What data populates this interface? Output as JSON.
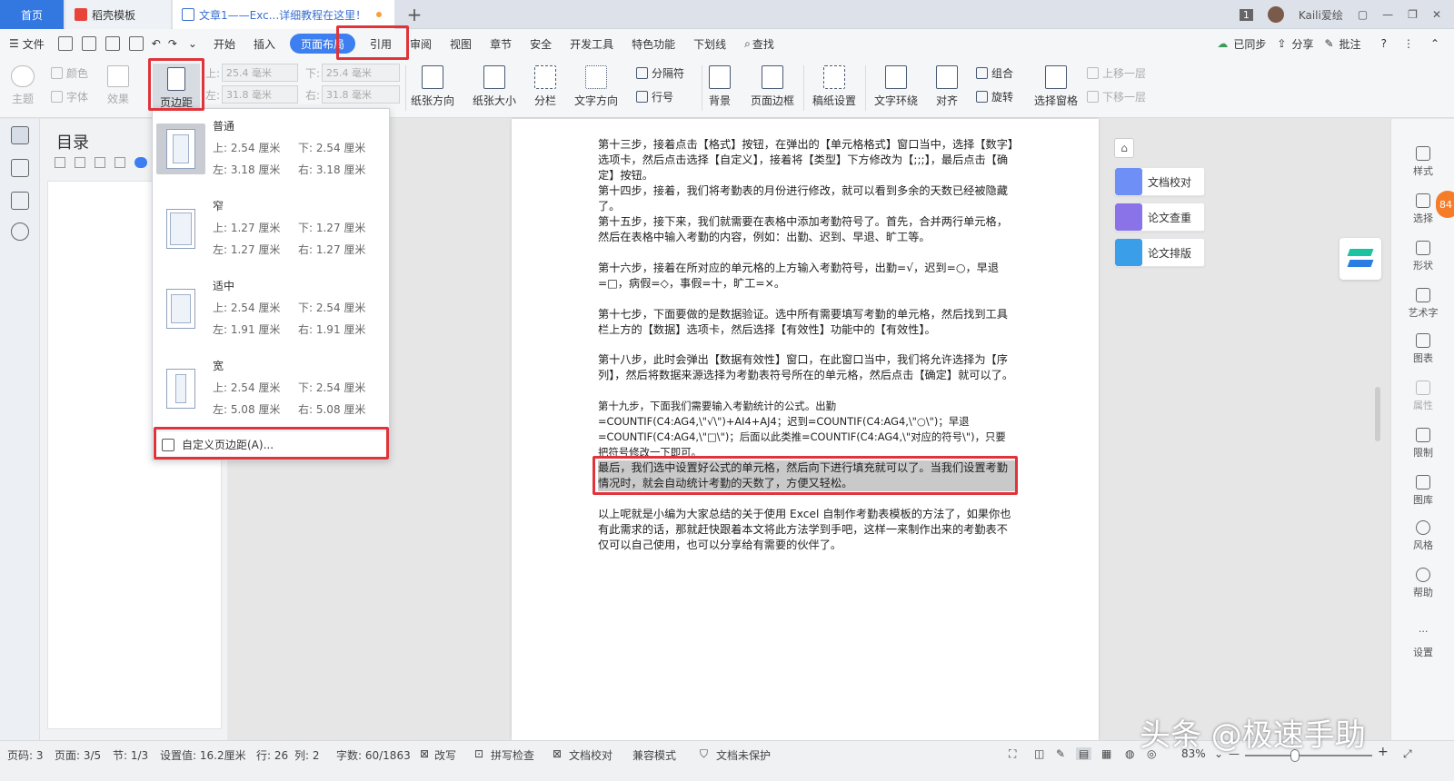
{
  "tabs": {
    "home": "首页",
    "templates": "稻壳模板",
    "doc": "文章1——Exc...详细教程在这里！",
    "plus": "+"
  },
  "window": {
    "page_count": "1",
    "user": "Kaili爱绘"
  },
  "menu": {
    "file": "文件",
    "items": [
      "开始",
      "插入",
      "页面布局",
      "引用",
      "审阅",
      "视图",
      "章节",
      "安全",
      "开发工具",
      "特色功能",
      "下划线"
    ],
    "search": "查找",
    "sync": "已同步",
    "share": "分享",
    "comment": "批注",
    "help": "?"
  },
  "ribbon": {
    "theme": "主题",
    "color": "颜色",
    "font": "字体",
    "effect": "效果",
    "margin": "页边距",
    "top_label": "上:",
    "top_val": "25.4 毫米",
    "bottom_label": "下:",
    "bottom_val": "25.4 毫米",
    "left_label": "左:",
    "left_val": "31.8 毫米",
    "right_label": "右:",
    "right_val": "31.8 毫米",
    "orientation": "纸张方向",
    "size": "纸张大小",
    "columns": "分栏",
    "text_dir": "文字方向",
    "break": "分隔符",
    "line_num": "行号",
    "background": "背景",
    "page_border": "页面边框",
    "manuscript": "稿纸设置",
    "wrap": "文字环绕",
    "align": "对齐",
    "group": "组合",
    "rotate": "旋转",
    "selection_pane": "选择窗格",
    "bring_forward": "上移一层",
    "send_backward": "下移一层"
  },
  "nav": {
    "title": "目录"
  },
  "dropdown": {
    "options": [
      {
        "name": "普通",
        "top": "上: 2.54 厘米",
        "bottom": "下: 2.54 厘米",
        "left": "左: 3.18 厘米",
        "right": "右: 3.18 厘米"
      },
      {
        "name": "窄",
        "top": "上: 1.27 厘米",
        "bottom": "下: 1.27 厘米",
        "left": "左: 1.27 厘米",
        "right": "右: 1.27 厘米"
      },
      {
        "name": "适中",
        "top": "上: 2.54 厘米",
        "bottom": "下: 2.54 厘米",
        "left": "左: 1.91 厘米",
        "right": "右: 1.91 厘米"
      },
      {
        "name": "宽",
        "top": "上: 2.54 厘米",
        "bottom": "下: 2.54 厘米",
        "left": "左: 5.08 厘米",
        "right": "右: 5.08 厘米"
      }
    ],
    "custom": "自定义页边距(A)..."
  },
  "document": {
    "paragraphs": [
      "第十三步，接着点击【格式】按钮，在弹出的【单元格格式】窗口当中，选择【数字】选项卡，然后点击选择【自定义】，接着将【类型】下方修改为【;;;】，最后点击【确定】按钮。",
      "第十四步，接着，我们将考勤表的月份进行修改，就可以看到多余的天数已经被隐藏了。",
      "第十五步，接下来，我们就需要在表格中添加考勤符号了。首先，合并两行单元格，然后在表格中输入考勤的内容，例如：出勤、迟到、早退、旷工等。",
      "第十六步，接着在所对应的单元格的上方输入考勤符号，出勤=√，迟到=○，早退=□，病假=◇，事假=十，旷工=×。",
      "第十七步，下面要做的是数据验证。选中所有需要填写考勤的单元格，然后找到工具栏上方的【数据】选项卡，然后选择【有效性】功能中的【有效性】。",
      "第十八步，此时会弹出【数据有效性】窗口，在此窗口当中，我们将允许选择为【序列】，然后将数据来源选择为考勤表符号所在的单元格，然后点击【确定】就可以了。",
      "第十九步，下面我们需要输入考勤统计的公式。出勤=COUNTIF(C4:AG4,\\\"√\\\")+AI4+AJ4；迟到=COUNTIF(C4:AG4,\\\"○\\\")；早退=COUNTIF(C4:AG4,\\\"□\\\")；后面以此类推=COUNTIF(C4:AG4,\\\"对应的符号\\\")，只要把符号修改一下即可。",
      "最后，我们选中设置好公式的单元格，然后向下进行填充就可以了。当我们设置考勤情况时，就会自动统计考勤的天数了，方便又轻松。",
      "以上呢就是小编为大家总结的关于使用 Excel 自制作考勤表模板的方法了，如果你也有此需求的话，那就赶快跟着本文将此方法学到手吧，这样一来制作出来的考勤表不仅可以自己使用，也可以分享给有需要的伙伴了。"
    ]
  },
  "side_panel": {
    "proofread": "文档校对",
    "plagiarism": "论文查重",
    "format": "论文排版"
  },
  "right_tools": [
    "样式",
    "选择",
    "形状",
    "艺术字",
    "图表",
    "属性",
    "限制",
    "图库",
    "风格",
    "帮助",
    "设置"
  ],
  "badge": "84",
  "status": {
    "page_code": "页码: 3",
    "page": "页面: 3/5",
    "section": "节: 1/3",
    "setting": "设置值: 16.2厘米",
    "row": "行: 26",
    "col": "列: 2",
    "words": "字数: 60/1863",
    "revise": "改写",
    "spell": "拼写检查",
    "proof": "文档校对",
    "compat": "兼容模式",
    "unprotected": "文档未保护",
    "zoom": "83%"
  },
  "watermark": "头条 @极速手助",
  "colors": {
    "accent": "#3d7ff0",
    "highlight": "#e0343b"
  }
}
